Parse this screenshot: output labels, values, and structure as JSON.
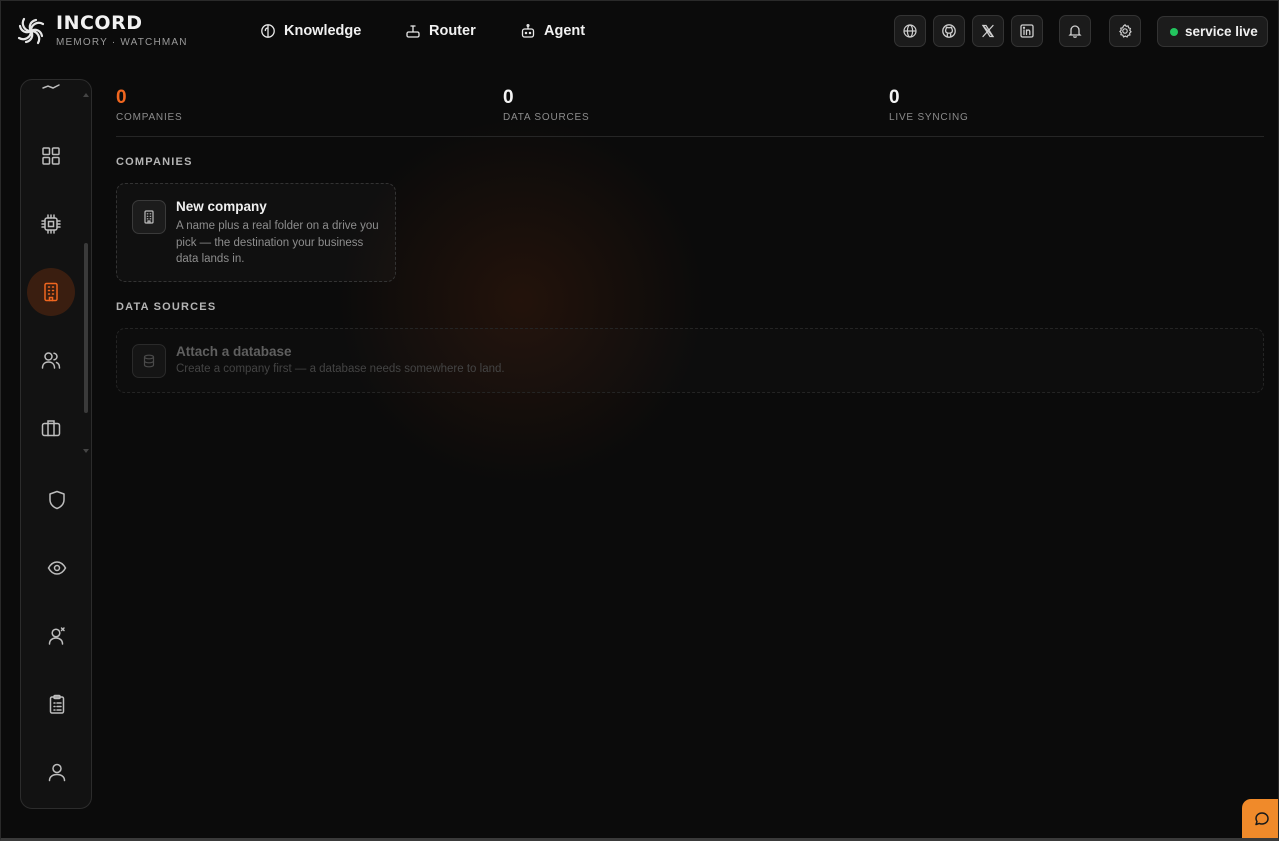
{
  "brand": {
    "name": "INCORD",
    "subtitle": "MEMORY · WATCHMAN"
  },
  "nav": [
    {
      "label": "Knowledge",
      "icon": "brain-icon"
    },
    {
      "label": "Router",
      "icon": "router-icon"
    },
    {
      "label": "Agent",
      "icon": "robot-icon"
    }
  ],
  "header_actions": [
    {
      "icon": "globe-icon"
    },
    {
      "icon": "github-icon"
    },
    {
      "icon": "x-logo-icon"
    },
    {
      "icon": "linkedin-icon"
    },
    {
      "icon": "bell-icon"
    },
    {
      "icon": "gear-icon"
    }
  ],
  "status": {
    "label": "service live",
    "color": "#22c55e"
  },
  "sidebar": {
    "items": [
      {
        "icon": "chart-line-icon"
      },
      {
        "icon": "grid-icon"
      },
      {
        "icon": "chip-icon"
      },
      {
        "icon": "building-icon",
        "active": true
      },
      {
        "icon": "users-icon"
      },
      {
        "icon": "briefcase-icon"
      },
      {
        "icon": "shield-icon"
      },
      {
        "icon": "eye-icon"
      },
      {
        "icon": "user-search-icon"
      },
      {
        "icon": "clipboard-icon"
      },
      {
        "icon": "user-icon"
      }
    ]
  },
  "stats": [
    {
      "value": "0",
      "label": "COMPANIES"
    },
    {
      "value": "0",
      "label": "DATA SOURCES"
    },
    {
      "value": "0",
      "label": "LIVE SYNCING"
    }
  ],
  "companies": {
    "title": "COMPANIES",
    "new_card": {
      "title": "New company",
      "description": "A name plus a real folder on a drive you pick — the destination your business data lands in."
    }
  },
  "data_sources": {
    "title": "DATA SOURCES",
    "attach_card": {
      "title": "Attach a database",
      "description": "Create a company first — a database needs somewhere to land."
    }
  },
  "colors": {
    "accent": "#f0661f",
    "fab": "#f08a2a"
  }
}
